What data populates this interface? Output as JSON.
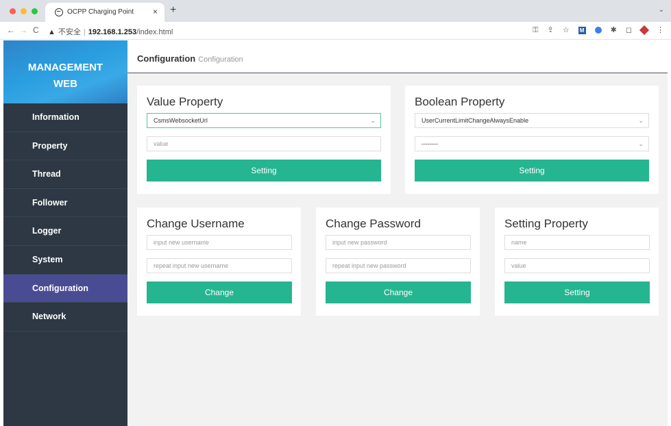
{
  "browser": {
    "tab_title": "OCPP Charging Point",
    "tab_close": "×",
    "new_tab": "+",
    "tab_menu": "⌄",
    "address": {
      "warning_icon": "▲",
      "security_label": "不安全",
      "separator": "|",
      "host": "192.168.1.253",
      "path": "/index.html"
    }
  },
  "sidebar": {
    "brand_line1": "MANAGEMENT",
    "brand_line2": "WEB",
    "items": [
      {
        "label": "Information"
      },
      {
        "label": "Property"
      },
      {
        "label": "Thread"
      },
      {
        "label": "Follower"
      },
      {
        "label": "Logger"
      },
      {
        "label": "System"
      },
      {
        "label": "Configuration",
        "active": true
      },
      {
        "label": "Network"
      }
    ]
  },
  "header": {
    "title": "Configuration",
    "subtitle": "Configuration"
  },
  "value_property": {
    "title": "Value Property",
    "select_value": "CsmsWebsocketUrl",
    "value_placeholder": "value",
    "button_label": "Setting"
  },
  "boolean_property": {
    "title": "Boolean Property",
    "select_value": "UserCurrentLimitChangeAlwaysEnable",
    "select2_value": "--------",
    "button_label": "Setting"
  },
  "change_username": {
    "title": "Change Username",
    "placeholder1": "input new username",
    "placeholder2": "repeat input new username",
    "button_label": "Change"
  },
  "change_password": {
    "title": "Change Password",
    "placeholder1": "input new password",
    "placeholder2": "repeat input new password",
    "button_label": "Change"
  },
  "setting_property": {
    "title": "Setting Property",
    "placeholder1": "name",
    "placeholder2": "value",
    "button_label": "Setting"
  },
  "colors": {
    "accent_green": "#25b590",
    "sidebar_bg": "#2d3844",
    "sidebar_active": "#4a4c93",
    "brand_blue": "#2a9fe0"
  }
}
